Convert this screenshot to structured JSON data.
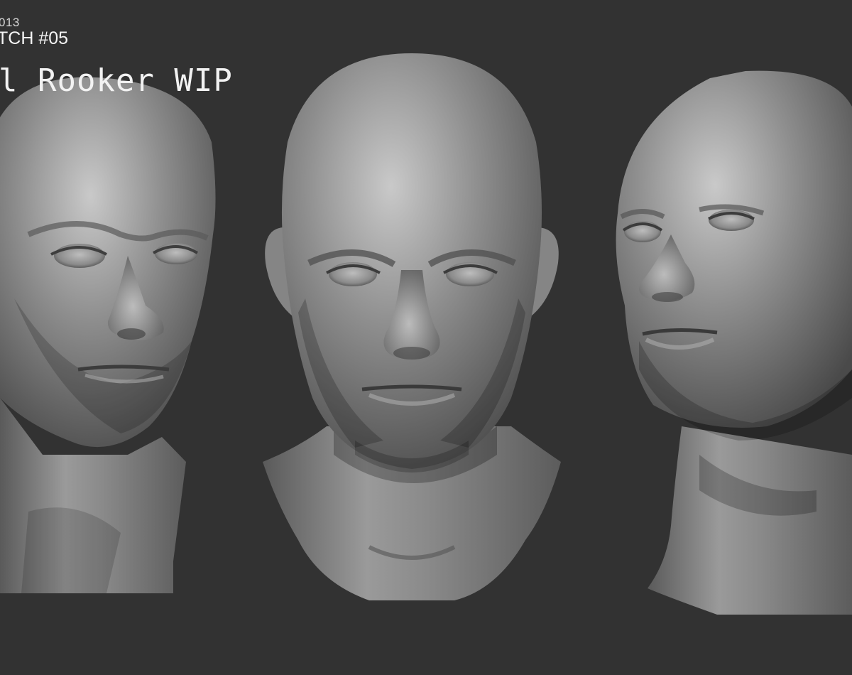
{
  "caption": {
    "year": "013",
    "sketch": "TCH #05",
    "title": "l Rooker WIP"
  },
  "colors": {
    "background": "#323232",
    "clay": "#8a8a8a",
    "text": "#f2f2f2"
  },
  "views": [
    "three-quarter-left",
    "front",
    "three-quarter-right"
  ]
}
